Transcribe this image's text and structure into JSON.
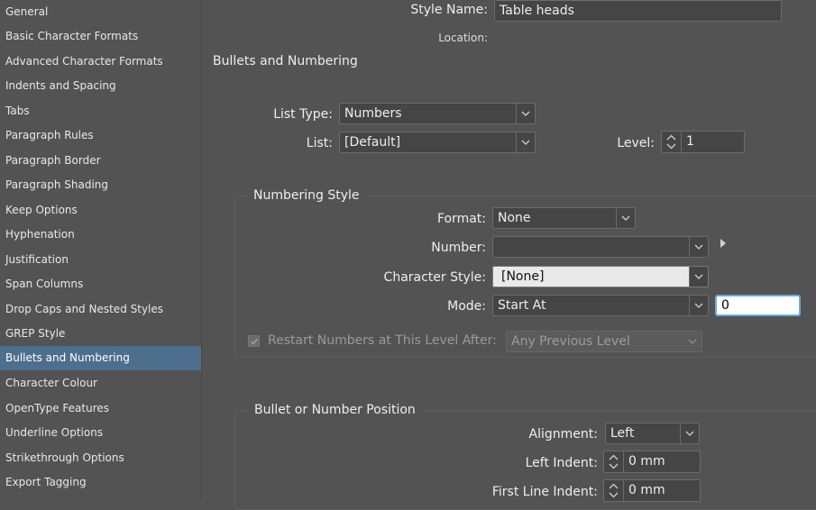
{
  "sidebar": {
    "items": [
      {
        "label": "General"
      },
      {
        "label": "Basic Character Formats"
      },
      {
        "label": "Advanced Character Formats"
      },
      {
        "label": "Indents and Spacing"
      },
      {
        "label": "Tabs"
      },
      {
        "label": "Paragraph Rules"
      },
      {
        "label": "Paragraph Border"
      },
      {
        "label": "Paragraph Shading"
      },
      {
        "label": "Keep Options"
      },
      {
        "label": "Hyphenation"
      },
      {
        "label": "Justification"
      },
      {
        "label": "Span Columns"
      },
      {
        "label": "Drop Caps and Nested Styles"
      },
      {
        "label": "GREP Style"
      },
      {
        "label": "Bullets and Numbering"
      },
      {
        "label": "Character Colour"
      },
      {
        "label": "OpenType Features"
      },
      {
        "label": "Underline Options"
      },
      {
        "label": "Strikethrough Options"
      },
      {
        "label": "Export Tagging"
      }
    ],
    "selected": "Bullets and Numbering"
  },
  "header": {
    "style_name_label": "Style Name:",
    "style_name_value": "Table heads",
    "location_label": "Location:",
    "section_title": "Bullets and Numbering"
  },
  "list": {
    "list_type_label": "List Type:",
    "list_type_value": "Numbers",
    "list_label": "List:",
    "list_value": "[Default]",
    "level_label": "Level:",
    "level_value": "1"
  },
  "numbering_style": {
    "title": "Numbering Style",
    "format_label": "Format:",
    "format_value": "None",
    "number_label": "Number:",
    "number_value": "",
    "char_style_label": "Character Style:",
    "char_style_value": "[None]",
    "mode_label": "Mode:",
    "mode_value": "Start At",
    "start_at_value": "0",
    "restart_label": "Restart Numbers at This Level After:",
    "restart_checked": true,
    "restart_value": "Any Previous Level"
  },
  "position": {
    "title": "Bullet or Number Position",
    "alignment_label": "Alignment:",
    "alignment_value": "Left",
    "left_indent_label": "Left Indent:",
    "left_indent_value": "0 mm",
    "first_line_indent_label": "First Line Indent:",
    "first_line_indent_value": "0 mm"
  }
}
